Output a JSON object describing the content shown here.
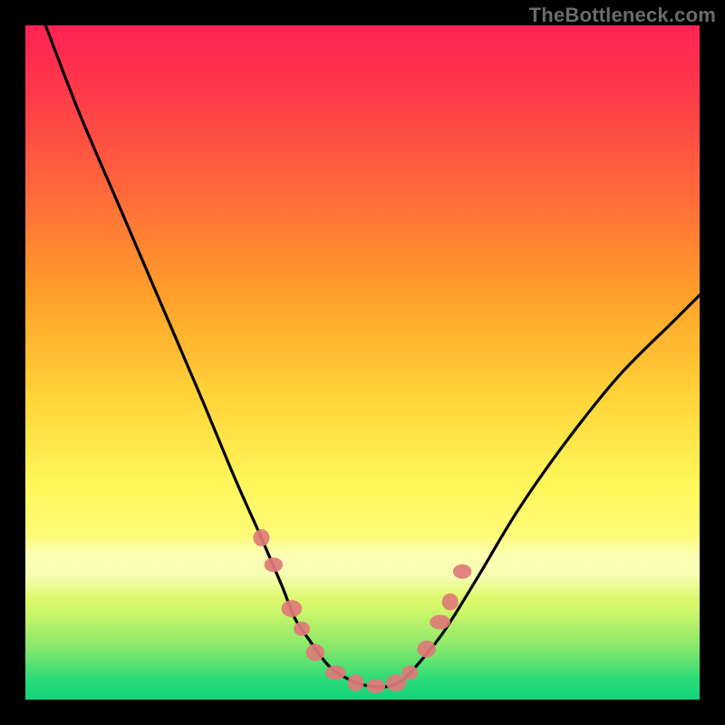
{
  "watermark": "TheBottleneck.com",
  "colors": {
    "curve_stroke": "#000000",
    "marker_fill": "#e07a7a",
    "marker_stroke": "#d66a6a",
    "gradient_top": "#ff2255",
    "gradient_bottom": "#15d27a"
  },
  "chart_data": {
    "type": "line",
    "title": "",
    "xlabel": "",
    "ylabel": "",
    "xlim": [
      0,
      100
    ],
    "ylim": [
      0,
      100
    ],
    "grid": false,
    "legend": null,
    "series": [
      {
        "name": "bottleneck-curve",
        "x": [
          3,
          8,
          14,
          20,
          26,
          31,
          35,
          38,
          40,
          42,
          45,
          48,
          51,
          54,
          56,
          58,
          62,
          67,
          73,
          80,
          88,
          96,
          100
        ],
        "y": [
          100,
          87,
          73,
          59,
          45,
          33,
          24,
          17,
          12,
          9,
          5,
          3,
          2,
          2,
          3,
          5,
          10,
          18,
          28,
          38,
          48,
          56,
          60
        ]
      }
    ],
    "markers": {
      "name": "highlighted-points",
      "x": [
        35.0,
        36.8,
        39.5,
        41.0,
        43.0,
        46.0,
        49.0,
        52.0,
        55.0,
        57.0,
        59.5,
        61.5,
        63.0,
        64.8
      ],
      "y": [
        24.0,
        20.0,
        13.5,
        10.5,
        7.0,
        4.0,
        2.5,
        2.0,
        2.5,
        4.0,
        7.5,
        11.5,
        14.5,
        19.0
      ]
    }
  }
}
